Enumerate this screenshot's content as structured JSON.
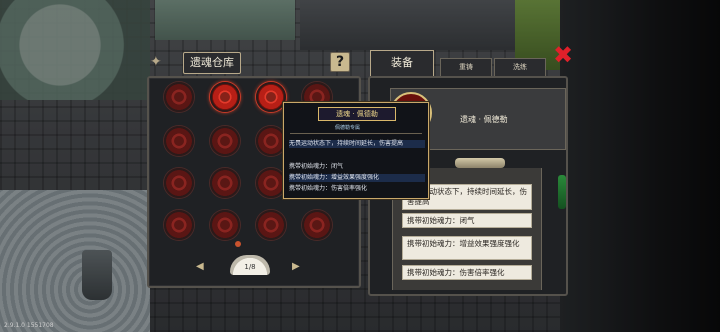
{
  "warehouse": {
    "title": "遗魂仓库",
    "help": "?",
    "page": "1/8",
    "slots": [
      {
        "state": "dim"
      },
      {
        "state": "bright"
      },
      {
        "state": "bright"
      },
      {
        "state": "dim"
      },
      {
        "state": "dim"
      },
      {
        "state": "dim"
      },
      {
        "state": "dim"
      },
      {
        "state": "dim"
      },
      {
        "state": "dim"
      },
      {
        "state": "dim"
      },
      {
        "state": "dim"
      },
      {
        "state": "dim"
      },
      {
        "state": "dim"
      },
      {
        "state": "dim"
      },
      {
        "state": "dim"
      },
      {
        "state": "dim"
      }
    ]
  },
  "equipment": {
    "tab_active": "装备",
    "tab2": "重铸",
    "tab3": "洗练",
    "item_name": "遗魂 · 佩德勒",
    "descriptions": [
      "无畏运动状态下，持续时间延长，伤害提高",
      "携带初始魂力：闭气",
      "携带初始魂力：增益效果强度强化",
      "携带初始魂力：伤害倍率强化"
    ]
  },
  "tooltip": {
    "title": "遗魂 · 佩德勒",
    "subtitle": "佩德勒专属",
    "lines": [
      "无畏运动状态下，持续时间延长，伤害提高",
      "携带初始魂力：闭气",
      "携带初始魂力：增益效果强度强化",
      "携带初始魂力：伤害倍率强化"
    ]
  },
  "close_icon": "✖",
  "version": "2.9.1.0 1551708"
}
